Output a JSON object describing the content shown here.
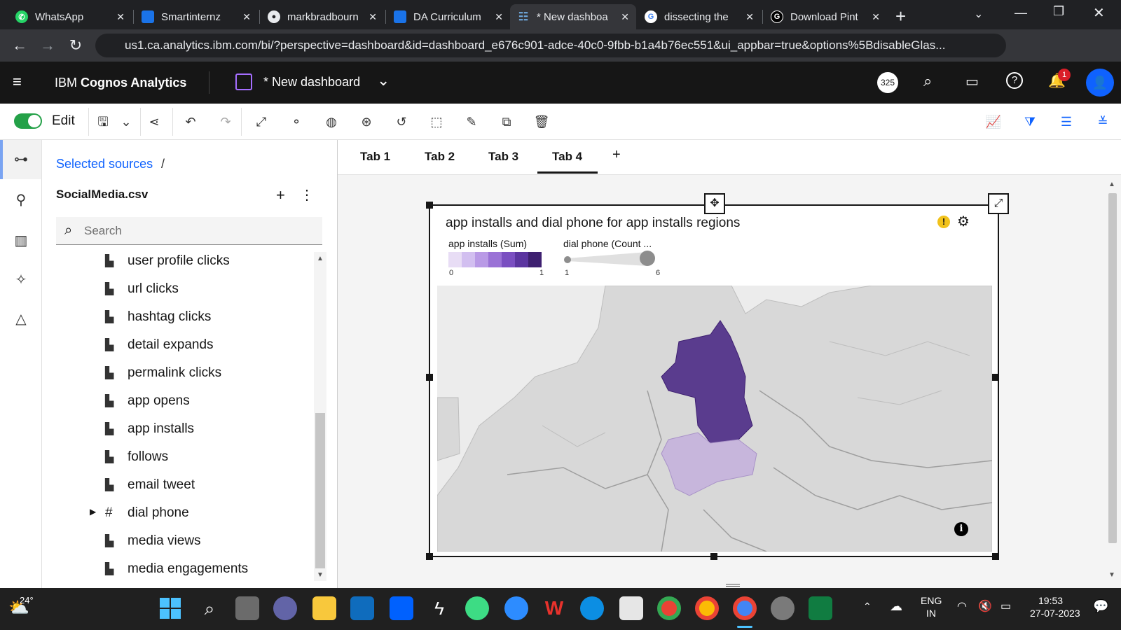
{
  "browser": {
    "tabs": [
      {
        "title": "WhatsApp",
        "icon": "whatsapp-icon",
        "color": "#25d366"
      },
      {
        "title": "Smartinternz",
        "icon": "smartinternz-icon",
        "color": "#1a73e8"
      },
      {
        "title": "markbradbourn",
        "icon": "github-icon",
        "color": "#ffffff"
      },
      {
        "title": "DA Curriculum",
        "icon": "smartinternz-icon",
        "color": "#1a73e8"
      },
      {
        "title": "* New dashboa",
        "icon": "cognos-icon",
        "color": "#6fa8dc"
      },
      {
        "title": "dissecting the",
        "icon": "google-icon",
        "color": "#ffffff"
      },
      {
        "title": "Download Pint",
        "icon": "g-icon",
        "color": "#000000"
      }
    ],
    "new_tab": "+",
    "url": "us1.ca.analytics.ibm.com/bi/?perspective=dashboard&id=dashboard_e676c901-adce-40c0-9fbb-b1a4b76ec551&ui_appbar=true&options%5BdisableGlas..."
  },
  "app": {
    "product": "IBM",
    "product_bold": "Cognos Analytics",
    "dashboard_title": "* New dashboard",
    "badge_count": "325",
    "notification_count": "1",
    "edit_label": "Edit"
  },
  "panel": {
    "breadcrumb": "Selected sources",
    "breadcrumb_sep": "/",
    "source_name": "SocialMedia.csv",
    "search_placeholder": "Search",
    "fields": [
      {
        "label": "user profile clicks",
        "type": "measure"
      },
      {
        "label": "url clicks",
        "type": "measure"
      },
      {
        "label": "hashtag clicks",
        "type": "measure"
      },
      {
        "label": "detail expands",
        "type": "measure"
      },
      {
        "label": "permalink clicks",
        "type": "measure"
      },
      {
        "label": "app opens",
        "type": "measure"
      },
      {
        "label": "app installs",
        "type": "measure"
      },
      {
        "label": "follows",
        "type": "measure"
      },
      {
        "label": "email tweet",
        "type": "measure"
      },
      {
        "label": "dial phone",
        "type": "identifier"
      },
      {
        "label": "media views",
        "type": "measure"
      },
      {
        "label": "media engagements",
        "type": "measure"
      }
    ]
  },
  "tabs": [
    "Tab 1",
    "Tab 2",
    "Tab 3",
    "Tab 4"
  ],
  "add_tab": "+",
  "active_tab": "Tab 4",
  "widget": {
    "title": "app installs and dial phone for app installs regions",
    "legend_color_label": "app installs (Sum)",
    "legend_color_min": "0",
    "legend_color_max": "1",
    "legend_size_label": "dial phone (Count ...",
    "legend_size_min": "1",
    "legend_size_max": "6",
    "swatches": [
      "#e8ddf5",
      "#d2bff0",
      "#b99ae6",
      "#9a72d6",
      "#7a4fc1",
      "#5b35a0",
      "#3e2070"
    ],
    "region_colors": {
      "high": "#5a3c8e",
      "low": "#c7b6dc",
      "base": "#d9d9d9"
    }
  },
  "taskbar": {
    "weather": "24°",
    "lang_top": "ENG",
    "lang_bottom": "IN",
    "time": "19:53",
    "date": "27-07-2023"
  }
}
